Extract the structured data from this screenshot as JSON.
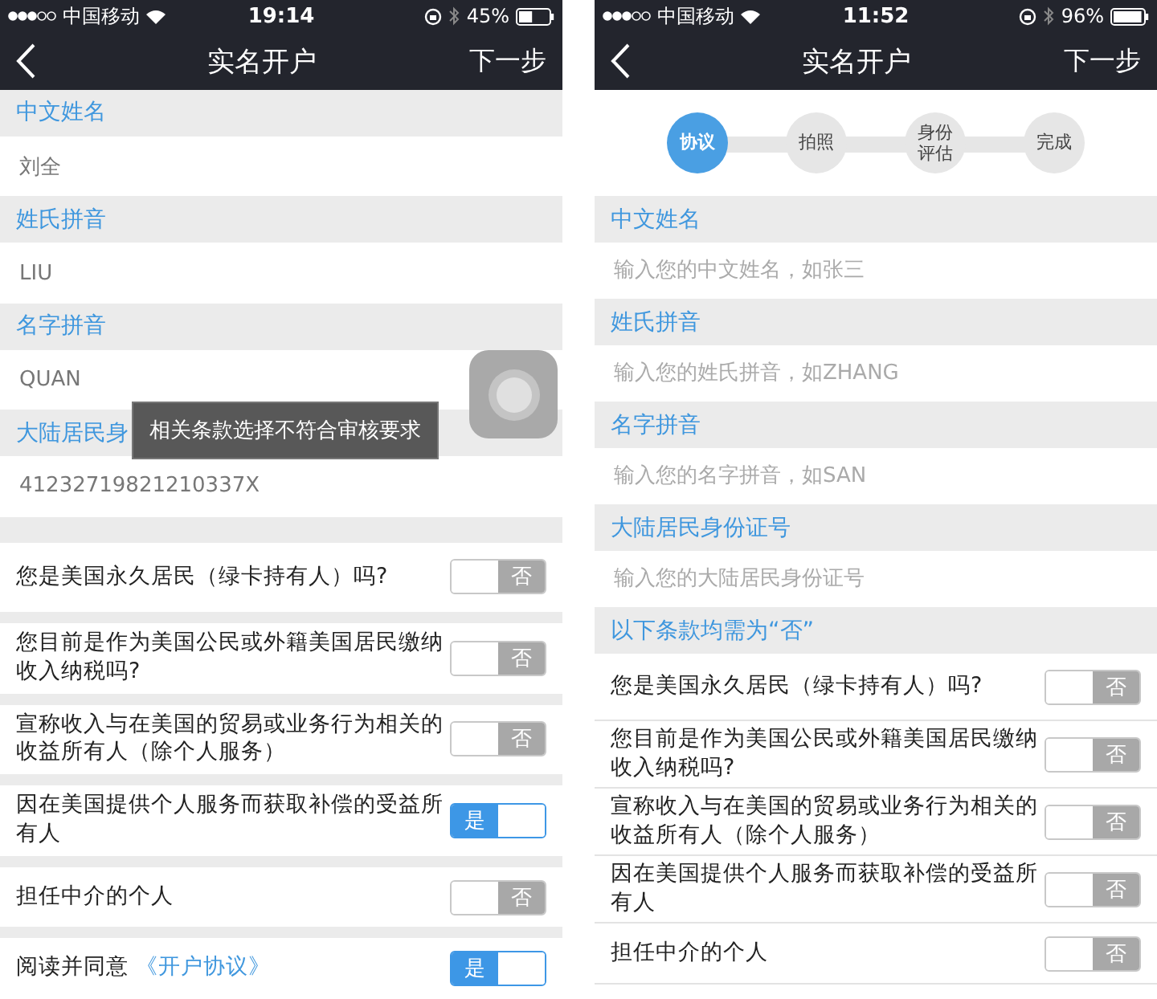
{
  "screens": [
    {
      "kind": "grouped",
      "status_bar": {
        "carrier": "中国移动",
        "time": "19:14",
        "battery": "45%"
      },
      "nav": {
        "title": "实名开户",
        "action": "下一步"
      },
      "fields": [
        {
          "label": "中文姓名",
          "value": "刘全"
        },
        {
          "label": "姓氏拼音",
          "value": "LIU"
        },
        {
          "label": "名字拼音",
          "value": "QUAN"
        },
        {
          "label": "大陆居民身",
          "value": "41232719821210337X"
        }
      ],
      "questions": [
        {
          "text": "您是美国永久居民（绿卡持有人）吗?",
          "toggle": "否",
          "on": false
        },
        {
          "text": "您目前是作为美国公民或外籍美国居民缴纳收入纳税吗?",
          "toggle": "否",
          "on": false
        },
        {
          "text": "宣称收入与在美国的贸易或业务行为相关的收益所有人（除个人服务）",
          "toggle": "否",
          "on": false
        },
        {
          "text": "因在美国提供个人服务而获取补偿的受益所有人",
          "toggle": "是",
          "on": true
        },
        {
          "text": "担任中介的个人",
          "toggle": "否",
          "on": false
        }
      ],
      "agreement": {
        "text": "阅读并同意",
        "link": "《开户协议》",
        "toggle": "是",
        "on": true
      },
      "toast": "相关条款选择不符合审核要求",
      "floating_button": true
    },
    {
      "kind": "lined",
      "status_bar": {
        "carrier": "中国移动",
        "time": "11:52",
        "battery": "96%"
      },
      "nav": {
        "title": "实名开户",
        "action": "下一步"
      },
      "steps": [
        {
          "label": "协议",
          "selected": true
        },
        {
          "label": "拍照",
          "selected": false
        },
        {
          "label": "身份评估",
          "selected": false
        },
        {
          "label": "完成",
          "selected": false
        }
      ],
      "fields": [
        {
          "label": "中文姓名",
          "placeholder": "输入您的中文姓名，如张三"
        },
        {
          "label": "姓氏拼音",
          "placeholder": "输入您的姓氏拼音，如ZHANG"
        },
        {
          "label": "名字拼音",
          "placeholder": "输入您的名字拼音，如SAN"
        },
        {
          "label": "大陆居民身份证号",
          "placeholder": "输入您的大陆居民身份证号"
        }
      ],
      "notice": "以下条款均需为“否”",
      "questions": [
        {
          "text": "您是美国永久居民（绿卡持有人）吗?",
          "toggle": "否",
          "on": false
        },
        {
          "text": "您目前是作为美国公民或外籍美国居民缴纳收入纳税吗?",
          "toggle": "否",
          "on": false
        },
        {
          "text": "宣称收入与在美国的贸易或业务行为相关的收益所有人（除个人服务）",
          "toggle": "否",
          "on": false
        },
        {
          "text": "因在美国提供个人服务而获取补偿的受益所有人",
          "toggle": "否",
          "on": false
        },
        {
          "text": "担任中介的个人",
          "toggle": "否",
          "on": false
        }
      ]
    }
  ]
}
